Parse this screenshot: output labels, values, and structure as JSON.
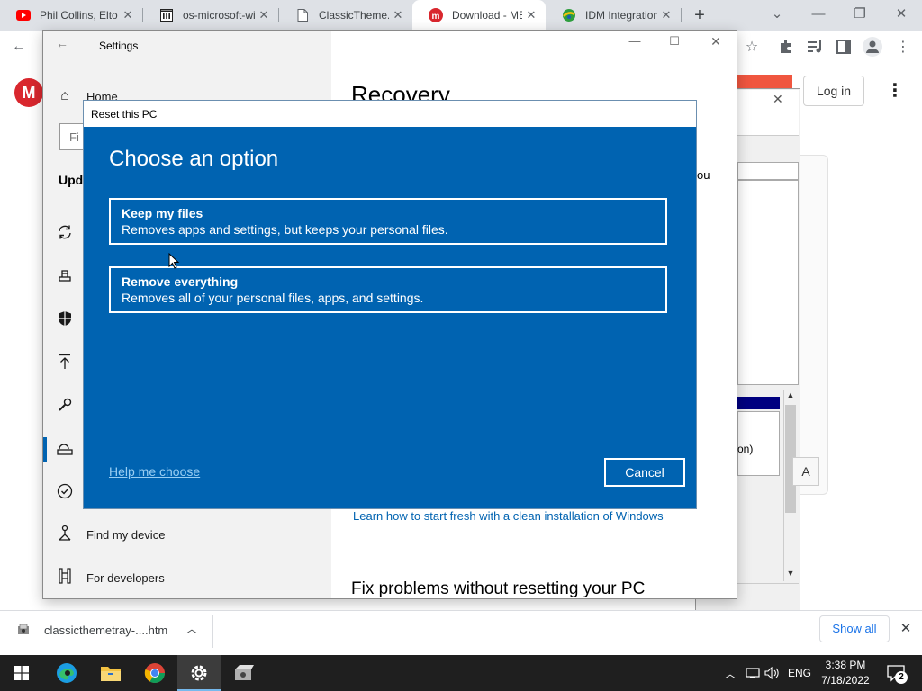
{
  "browser": {
    "tabs": [
      {
        "title": "Phil Collins, Elto",
        "icon": "youtube-icon"
      },
      {
        "title": "os-microsoft-wi",
        "icon": "archive-icon"
      },
      {
        "title": "ClassicTheme.ex",
        "icon": "document-icon"
      },
      {
        "title": "Download - ME",
        "icon": "mega-icon"
      },
      {
        "title": "IDM Integration",
        "icon": "idm-icon"
      }
    ],
    "new_tab": "+",
    "page": {
      "login_label": "Log in",
      "logo_letter": "M"
    }
  },
  "settings": {
    "title": "Settings",
    "nav_home": "Home",
    "search_placeholder": "Fi",
    "section_partial": "Upd",
    "nav_find_device": "Find my device",
    "nav_for_developers": "For developers",
    "page_title": "Recovery",
    "partial_text": "ou",
    "learn_link": "Learn how to start fresh with a clean installation of Windows",
    "fix_heading": "Fix problems without resetting your PC"
  },
  "bg_dialog": {
    "partial_text": "on)",
    "btn_partial": "A"
  },
  "reset_dialog": {
    "title": "Reset this PC",
    "heading": "Choose an option",
    "options": [
      {
        "title": "Keep my files",
        "desc": "Removes apps and settings, but keeps your personal files."
      },
      {
        "title": "Remove everything",
        "desc": "Removes all of your personal files, apps, and settings."
      }
    ],
    "help_link": "Help me choose",
    "cancel": "Cancel",
    "bg_color": "#0063b1"
  },
  "downloads": {
    "filename": "classicthemetray-....htm",
    "show_all": "Show all"
  },
  "taskbar": {
    "lang": "ENG",
    "time": "3:38 PM",
    "date": "7/18/2022",
    "notif_count": "2"
  }
}
